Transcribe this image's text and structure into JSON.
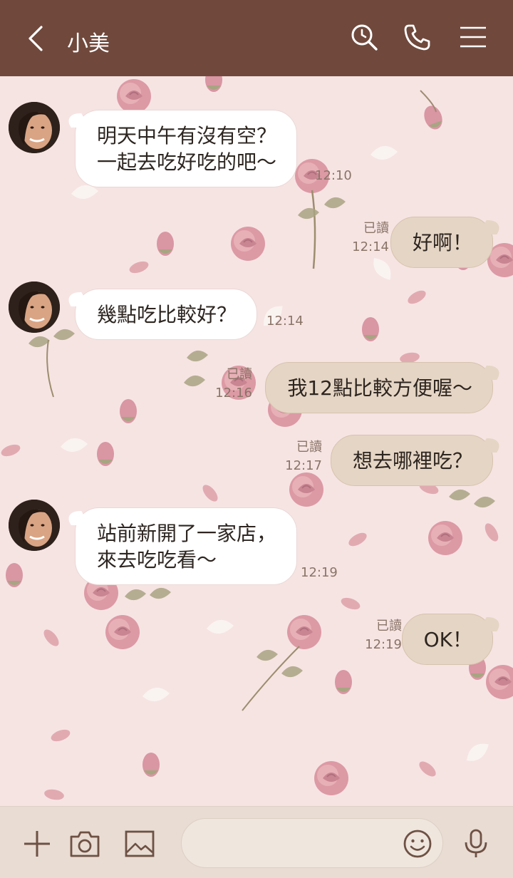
{
  "header": {
    "back_icon": "chevron-left-icon",
    "title": "小美",
    "icons": [
      "search-clock-icon",
      "phone-icon",
      "menu-icon"
    ]
  },
  "messages": [
    {
      "side": "in",
      "lines": [
        "明天中午有沒有空？",
        "一起去吃好吃的吧～"
      ],
      "time": "12:10"
    },
    {
      "side": "out",
      "lines": [
        "好啊！"
      ],
      "read": "已讀",
      "time": "12:14"
    },
    {
      "side": "in",
      "lines": [
        "幾點吃比較好？"
      ],
      "time": "12:14"
    },
    {
      "side": "out",
      "lines": [
        "我12點比較方便喔～"
      ],
      "read": "已讀",
      "time": "12:16"
    },
    {
      "side": "out",
      "lines": [
        "想去哪裡吃？"
      ],
      "read": "已讀",
      "time": "12:17"
    },
    {
      "side": "in",
      "lines": [
        "站前新開了一家店，",
        "來去吃吃看～"
      ],
      "time": "12:19"
    },
    {
      "side": "out",
      "lines": [
        "OK！"
      ],
      "read": "已讀",
      "time": "12:19"
    }
  ],
  "footer": {
    "icons": [
      "plus-icon",
      "camera-icon",
      "image-icon",
      "emoji-icon",
      "microphone-icon"
    ],
    "input_value": ""
  },
  "colors": {
    "header_bg": "#70493c",
    "chat_bg": "#f6e4e3",
    "incoming_bubble": "#ffffff",
    "outgoing_bubble": "#e5d5c4",
    "footer_bg": "#e8dcd3"
  }
}
